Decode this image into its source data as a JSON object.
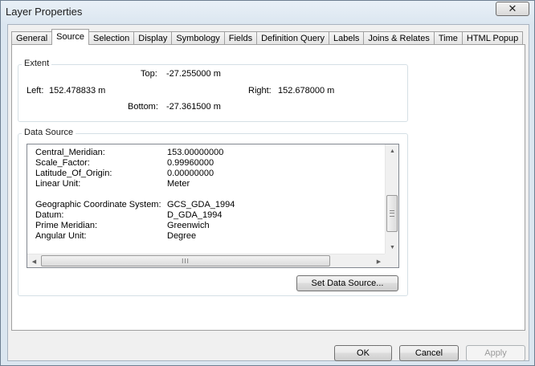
{
  "window": {
    "title": "Layer Properties",
    "close_label": "✕"
  },
  "tabs": [
    "General",
    "Source",
    "Selection",
    "Display",
    "Symbology",
    "Fields",
    "Definition Query",
    "Labels",
    "Joins & Relates",
    "Time",
    "HTML Popup"
  ],
  "active_tab": "Source",
  "extent": {
    "title": "Extent",
    "top_label": "Top:",
    "top_value": "-27.255000 m",
    "left_label": "Left:",
    "left_value": "152.478833 m",
    "right_label": "Right:",
    "right_value": "152.678000 m",
    "bottom_label": "Bottom:",
    "bottom_value": "-27.361500 m"
  },
  "data_source": {
    "title": "Data Source",
    "rows": [
      {
        "key": "Central_Meridian:",
        "value": "153.00000000"
      },
      {
        "key": "Scale_Factor:",
        "value": "0.99960000"
      },
      {
        "key": "Latitude_Of_Origin:",
        "value": "0.00000000"
      },
      {
        "key": "Linear Unit:",
        "value": "Meter"
      },
      {
        "key": "",
        "value": ""
      },
      {
        "key": "Geographic Coordinate System:",
        "value": "GCS_GDA_1994"
      },
      {
        "key": "Datum:",
        "value": "D_GDA_1994"
      },
      {
        "key": "Prime Meridian:",
        "value": "Greenwich"
      },
      {
        "key": "Angular Unit:",
        "value": "Degree"
      }
    ],
    "hscroll_grip": "III",
    "set_button": "Set Data Source..."
  },
  "footer": {
    "ok": "OK",
    "cancel": "Cancel",
    "apply": "Apply"
  }
}
